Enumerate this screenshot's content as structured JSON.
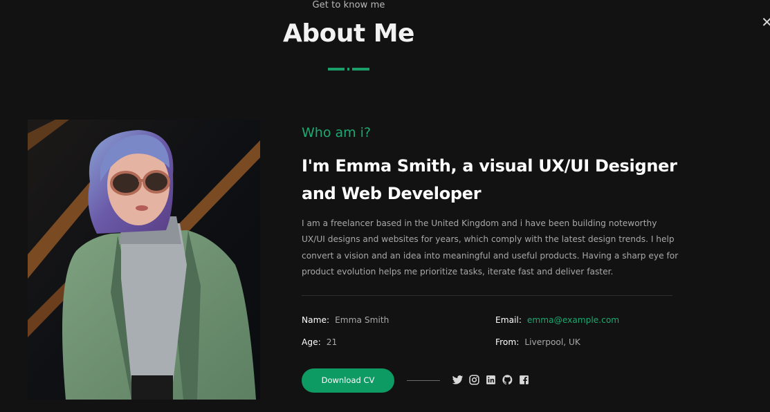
{
  "header": {
    "eyebrow": "Get to know me",
    "title": "About Me"
  },
  "about": {
    "who": "Who am i?",
    "headline": "I'm Emma Smith, a visual UX/UI Designer and Web Developer",
    "bio": "I am a freelancer based in the United Kingdom and i have been building noteworthy UX/UI designs and websites for years, which comply with the latest design trends. I help convert a vision and an idea into meaningful and useful products. Having a sharp eye for product evolution helps me prioritize tasks, iterate fast and deliver faster.",
    "info": {
      "name_label": "Name:",
      "name_value": "Emma Smith",
      "email_label": "Email:",
      "email_value": "emma@example.com",
      "age_label": "Age:",
      "age_value": "21",
      "from_label": "From:",
      "from_value": "Liverpool, UK"
    },
    "download_label": "Download CV",
    "socials": [
      "twitter-icon",
      "instagram-icon",
      "linkedin-icon",
      "github-icon",
      "facebook-icon"
    ]
  },
  "colors": {
    "background": "#121212",
    "accent": "#1fa872",
    "button": "#0e9a63",
    "muted_text": "#a8a8a8"
  },
  "corner_glyph": "✕"
}
